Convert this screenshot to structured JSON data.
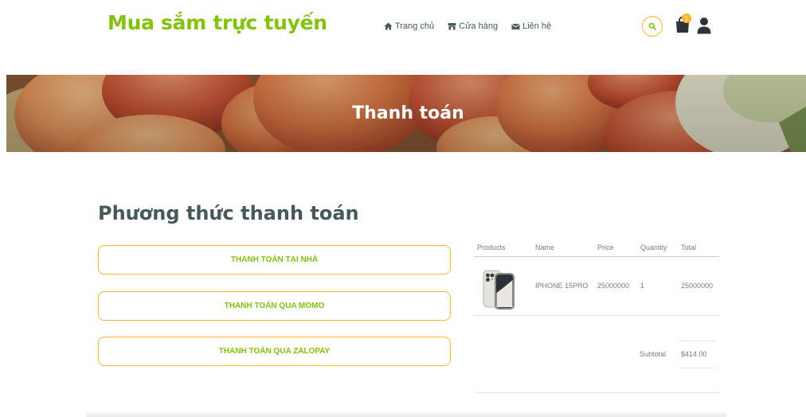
{
  "brand": "Mua sắm trực tuyến",
  "nav": {
    "items": [
      {
        "label": "Trang chủ",
        "icon": "home-icon"
      },
      {
        "label": "Cửa hàng",
        "icon": "store-icon"
      },
      {
        "label": "Liên hệ",
        "icon": "envelope-icon"
      }
    ]
  },
  "header": {
    "cart_count": "1",
    "icons": [
      "search-icon",
      "shopping-bag-icon",
      "user-icon"
    ]
  },
  "hero": {
    "title": "Thanh toán",
    "background": "peaches-photo"
  },
  "payment": {
    "title": "Phương thức thanh toán",
    "options": [
      "THANH TOÁN TẠI NHÀ",
      "THANH TOÁN QUA MOMO",
      "THANH TOÁN QUA ZALOPAY"
    ]
  },
  "order": {
    "columns": [
      "Products",
      "Name",
      "Price",
      "Quantity",
      "Total"
    ],
    "rows": [
      {
        "product_image": "iphone-image",
        "name": "IPHONE 15PRO",
        "price": "25000000",
        "quantity": "1",
        "total": "25000000"
      }
    ],
    "subtotal_label": "Subtotal",
    "subtotal_value": "$414.00"
  },
  "colors": {
    "primary": "#81c408",
    "secondary": "#ffb524",
    "text": "#45595b"
  }
}
